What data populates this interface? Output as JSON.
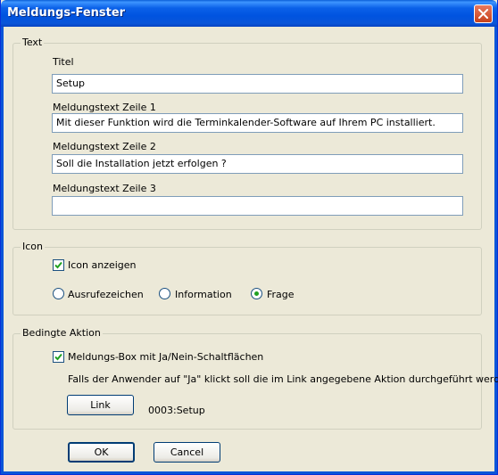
{
  "window": {
    "title": "Meldungs-Fenster"
  },
  "text_group": {
    "label": "Text",
    "titel_label": "Titel",
    "titel_value": "Setup",
    "zeile1_label": "Meldungstext Zeile 1",
    "zeile1_value": "Mit dieser Funktion wird die Terminkalender-Software auf Ihrem PC installiert.",
    "zeile2_label": "Meldungstext Zeile 2",
    "zeile2_value": "Soll die Installation jetzt erfolgen ?",
    "zeile3_label": "Meldungstext Zeile 3",
    "zeile3_value": ""
  },
  "icon_group": {
    "label": "Icon",
    "show_icon_label": "Icon anzeigen",
    "show_icon_checked": true,
    "options": [
      "Ausrufezeichen",
      "Information",
      "Frage"
    ],
    "selected": "Frage"
  },
  "action_group": {
    "label": "Bedingte Aktion",
    "yes_no_label": "Meldungs-Box mit Ja/Nein-Schaltflächen",
    "yes_no_checked": true,
    "description": "Falls der Anwender auf \"Ja\" klickt soll die im Link angegebene Aktion durchgeführt werden",
    "link_button": "Link",
    "link_value": "0003:Setup"
  },
  "footer": {
    "ok": "OK",
    "cancel": "Cancel"
  },
  "colors": {
    "title_bar": "#0053e0",
    "dialog_bg": "#ece9d8",
    "close_button": "#c6411c",
    "radio_dot": "#21a121"
  },
  "icons": {
    "close": "close-icon",
    "check": "check-icon"
  }
}
